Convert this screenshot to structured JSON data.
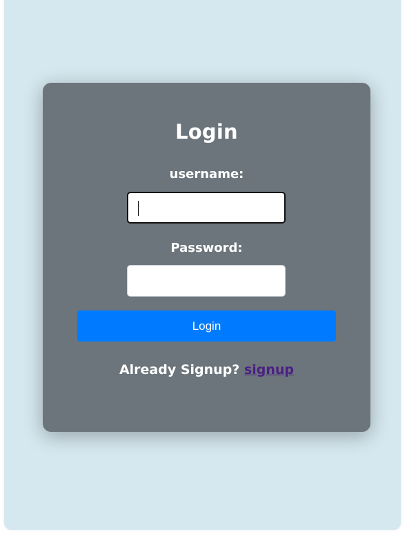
{
  "login": {
    "title": "Login",
    "username_label": "username:",
    "username_value": "",
    "password_label": "Password:",
    "password_value": "",
    "submit_label": "Login",
    "footer_text": "Already Signup?",
    "signup_link_label": "signup"
  }
}
